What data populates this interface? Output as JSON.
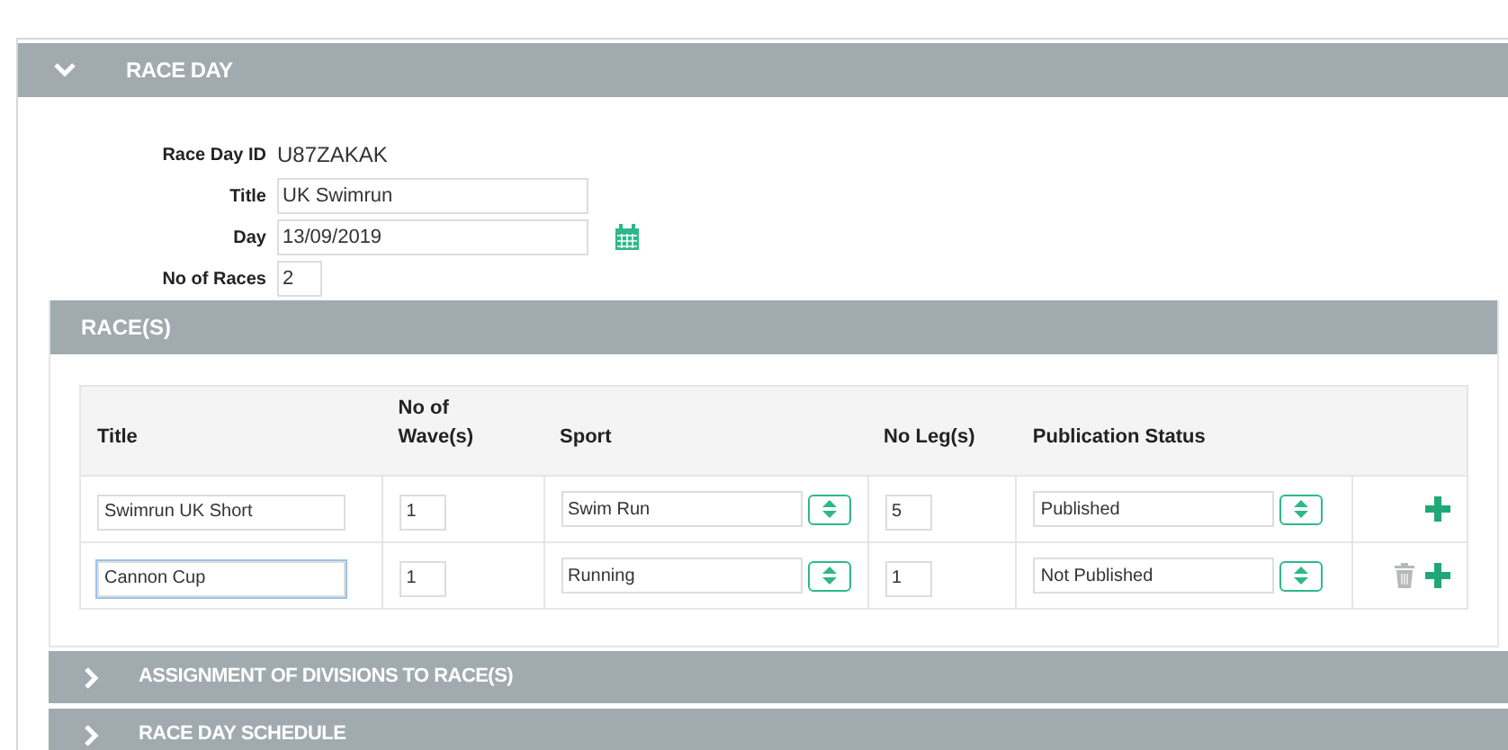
{
  "race_day": {
    "title": "RACE DAY",
    "expanded": true,
    "fields": [
      {
        "label": "Race Day ID",
        "kind": "text",
        "value": "U87ZAKAK"
      },
      {
        "label": "Title",
        "kind": "input",
        "value": "UK Swimrun"
      },
      {
        "label": "Day",
        "kind": "date",
        "value": "13/09/2019"
      },
      {
        "label": "No of Races",
        "kind": "small",
        "value": "2"
      }
    ],
    "races": {
      "title": "RACE(S)",
      "columns": [
        "Title",
        "No of Wave(s)",
        "Sport",
        "No Leg(s)",
        "Publication Status"
      ],
      "rows": [
        {
          "title": "Swimrun UK Short",
          "focused": false,
          "waves": "1",
          "sport": "Swim Run",
          "legs": "5",
          "status": "Published",
          "deletable": false
        },
        {
          "title": "Cannon Cup",
          "focused": true,
          "waves": "1",
          "sport": "Running",
          "legs": "1",
          "status": "Not Published",
          "deletable": true
        }
      ]
    }
  },
  "sections": [
    {
      "title": "ASSIGNMENT OF DIVISIONS TO RACE(S)",
      "expanded": false
    },
    {
      "title": "RACE DAY SCHEDULE",
      "expanded": false
    }
  ]
}
